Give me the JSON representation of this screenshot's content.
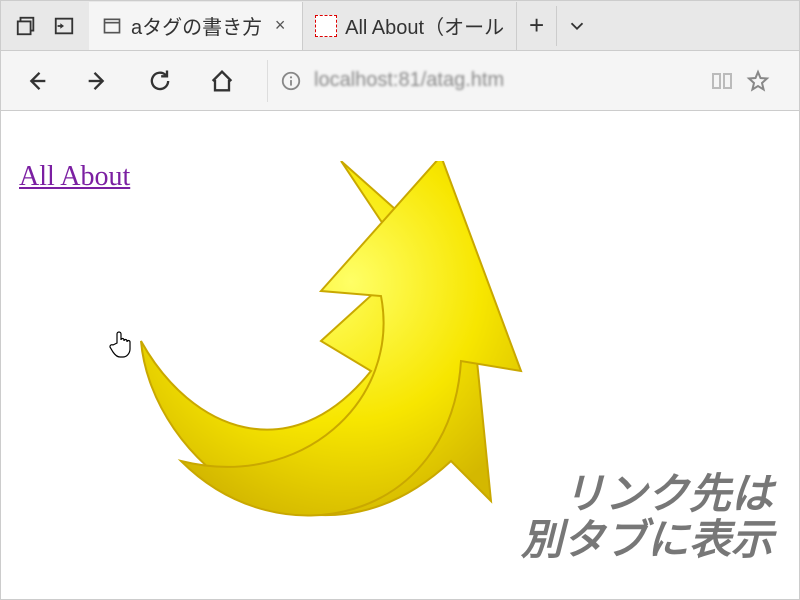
{
  "tabs": {
    "active": {
      "title": "aタグの書き方"
    },
    "inactive": {
      "title": "All About（オール"
    }
  },
  "address_bar": {
    "url": "localhost:81/atag.htm"
  },
  "page": {
    "link_text": "All About"
  },
  "annotation": {
    "line1": "リンク先は",
    "line2": "別タブに表示"
  }
}
